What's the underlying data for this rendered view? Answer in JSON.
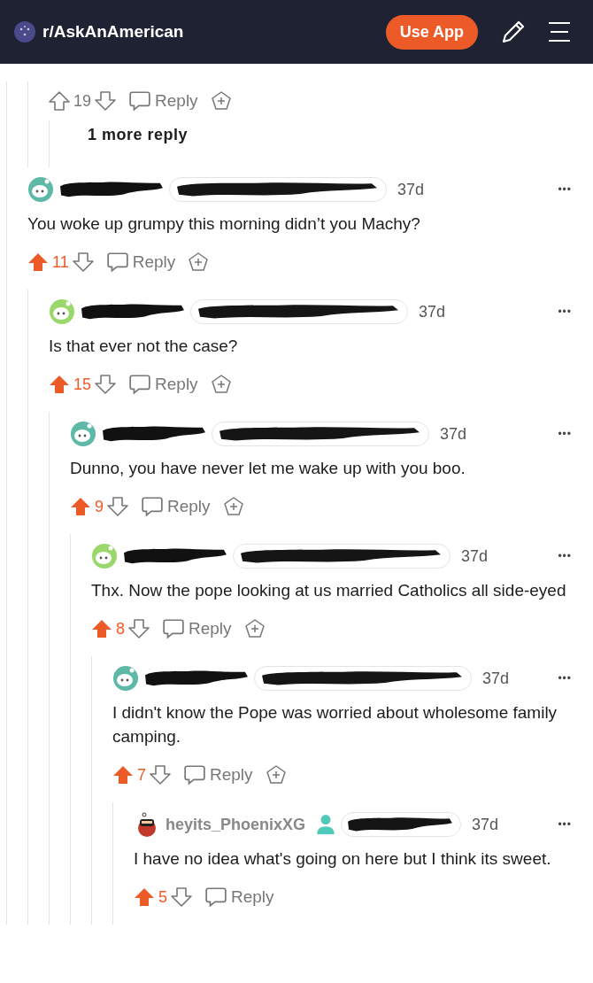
{
  "header": {
    "subreddit": "r/AskAnAmerican",
    "use_app": "Use App"
  },
  "prev_comment": {
    "score": "19",
    "upvoted": false,
    "reply": "Reply",
    "award": true
  },
  "more_replies": "1 more reply",
  "comments": [
    {
      "avatar": {
        "kind": "snoo",
        "color": "#5fb8a8"
      },
      "author_redacted": true,
      "flair_redacted": true,
      "badge": false,
      "time": "37d",
      "more": "•••",
      "body": "You woke up grumpy this morning didn’t you Machy?",
      "score": "11",
      "upvoted": true,
      "reply": "Reply",
      "award": true,
      "children": [
        {
          "avatar": {
            "kind": "snoo",
            "color": "#9ad86b"
          },
          "author_redacted": true,
          "flair_redacted": true,
          "badge": false,
          "time": "37d",
          "more": "•••",
          "body": "Is that ever not the case?",
          "score": "15",
          "upvoted": true,
          "reply": "Reply",
          "award": true,
          "children": [
            {
              "avatar": {
                "kind": "snoo",
                "color": "#5fb8a8"
              },
              "author_redacted": true,
              "flair_redacted": true,
              "badge": false,
              "time": "37d",
              "more": "•••",
              "body": "Dunno, you have never let me wake up with you boo.",
              "score": "9",
              "upvoted": true,
              "reply": "Reply",
              "award": true,
              "children": [
                {
                  "avatar": {
                    "kind": "snoo",
                    "color": "#9ad86b"
                  },
                  "author_redacted": true,
                  "flair_redacted": true,
                  "badge": false,
                  "time": "37d",
                  "more": "•••",
                  "body": "Thx. Now the pope looking at us married Catholics all side-eyed",
                  "score": "8",
                  "upvoted": true,
                  "reply": "Reply",
                  "award": true,
                  "children": [
                    {
                      "avatar": {
                        "kind": "snoo",
                        "color": "#5fb8a8"
                      },
                      "author_redacted": true,
                      "flair_redacted": true,
                      "badge": false,
                      "time": "37d",
                      "more": "•••",
                      "body": "I didn't know the Pope was worried about wholesome family camping.",
                      "score": "7",
                      "upvoted": true,
                      "reply": "Reply",
                      "award": true,
                      "children": [
                        {
                          "avatar": {
                            "kind": "custom",
                            "color": "#c0392b"
                          },
                          "author": "heyits_PhoenixXG",
                          "author_redacted": false,
                          "flair_redacted": true,
                          "badge": true,
                          "time": "37d",
                          "more": "•••",
                          "body": "I have no idea what's going on here but I think its sweet.",
                          "score": "5",
                          "upvoted": true,
                          "reply": "Reply",
                          "award": false
                        }
                      ]
                    }
                  ]
                }
              ]
            }
          ]
        }
      ]
    }
  ]
}
